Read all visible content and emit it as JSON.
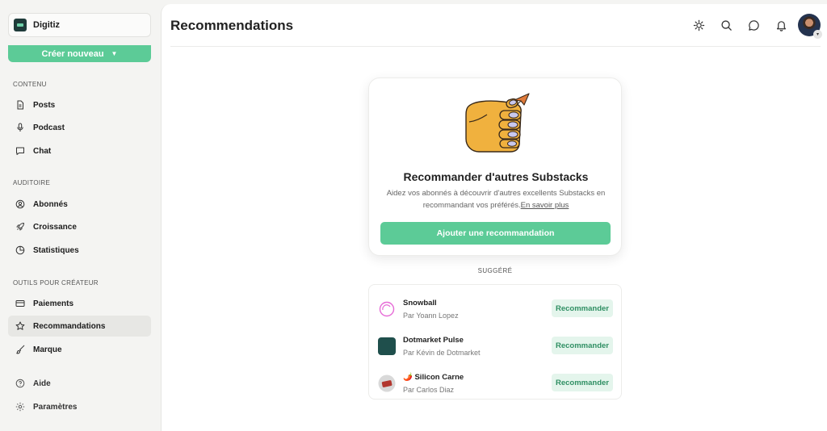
{
  "sidebar": {
    "publication": "Digitiz",
    "create_label": "Créer nouveau",
    "create_caret": "▼",
    "sections": {
      "content": "CONTENU",
      "audience": "AUDITOIRE",
      "tools": "OUTILS POUR CRÉATEUR"
    },
    "items": [
      {
        "label": "Posts",
        "icon": "document-icon"
      },
      {
        "label": "Podcast",
        "icon": "microphone-icon"
      },
      {
        "label": "Chat",
        "icon": "chat-bubble-icon"
      },
      {
        "label": "Abonnés",
        "icon": "user-circle-icon"
      },
      {
        "label": "Croissance",
        "icon": "rocket-icon"
      },
      {
        "label": "Statistiques",
        "icon": "pie-chart-icon"
      },
      {
        "label": "Paiements",
        "icon": "credit-card-icon"
      },
      {
        "label": "Recommandations",
        "icon": "star-icon",
        "active": true
      },
      {
        "label": "Marque",
        "icon": "paint-brush-icon"
      },
      {
        "label": "Aide",
        "icon": "help-circle-icon"
      },
      {
        "label": "Paramètres",
        "icon": "gear-icon"
      }
    ]
  },
  "header": {
    "title": "Recommendations",
    "icons": [
      "sun-icon",
      "search-icon",
      "chat-icon",
      "bell-icon"
    ],
    "avatar_caret": "▾"
  },
  "card": {
    "title": "Recommander d'autres Substacks",
    "description": "Aidez vos abonnés à découvrir d'autres excellents Substacks en recommandant vos préférés.",
    "link": "En savoir plus",
    "button": "Ajouter une recommandation"
  },
  "suggested": {
    "label": "SUGGÉRÉ",
    "items": [
      {
        "name": "Snowball",
        "author": "Par Yoann Lopez",
        "button": "Recommander"
      },
      {
        "name": "Dotmarket Pulse",
        "author": "Par Kévin de Dotmarket",
        "button": "Recommander"
      },
      {
        "name": "🌶️ Silicon Carne",
        "author": "Par Carlos Diaz",
        "button": "Recommander"
      }
    ]
  },
  "colors": {
    "accent": "#5ccb97",
    "accent_soft": "#e4f5ec",
    "sidebar_bg": "#f4f4f2"
  }
}
